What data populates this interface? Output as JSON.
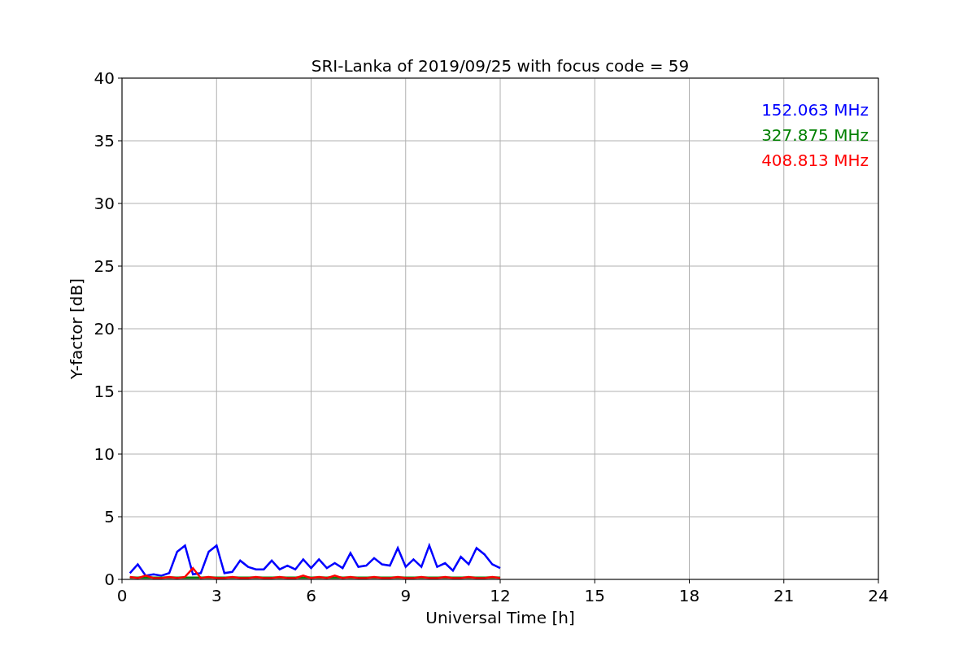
{
  "chart_data": {
    "type": "line",
    "title": "SRI-Lanka of 2019/09/25 with focus code = 59",
    "xlabel": "Universal Time [h]",
    "ylabel": "Y-factor [dB]",
    "x": [
      0.25,
      0.5,
      0.75,
      1.0,
      1.25,
      1.5,
      1.75,
      2.0,
      2.25,
      2.5,
      2.75,
      3.0,
      3.25,
      3.5,
      3.75,
      4.0,
      4.25,
      4.5,
      4.75,
      5.0,
      5.25,
      5.5,
      5.75,
      6.0,
      6.25,
      6.5,
      6.75,
      7.0,
      7.25,
      7.5,
      7.75,
      8.0,
      8.25,
      8.5,
      8.75,
      9.0,
      9.25,
      9.5,
      9.75,
      10.0,
      10.25,
      10.5,
      10.75,
      11.0,
      11.25,
      11.5,
      11.75,
      12.0
    ],
    "series": [
      {
        "name": "152.063 MHz",
        "color": "#0000ff",
        "values": [
          0.5,
          1.2,
          0.3,
          0.4,
          0.3,
          0.5,
          2.2,
          2.7,
          0.4,
          0.5,
          2.2,
          2.7,
          0.5,
          0.6,
          1.5,
          1.0,
          0.8,
          0.8,
          1.5,
          0.8,
          1.1,
          0.8,
          1.6,
          0.9,
          1.6,
          0.9,
          1.3,
          0.9,
          2.1,
          1.0,
          1.1,
          1.7,
          1.2,
          1.1,
          2.5,
          1.0,
          1.6,
          1.0,
          2.7,
          1.0,
          1.3,
          0.7,
          1.8,
          1.2,
          2.5,
          2.0,
          1.2,
          0.9
        ]
      },
      {
        "name": "327.875 MHz",
        "color": "#008000",
        "values": [
          0.15,
          0.15,
          0.15,
          0.15,
          0.15,
          0.15,
          0.15,
          0.15,
          0.15,
          0.15,
          0.15,
          0.15,
          0.15,
          0.15,
          0.15,
          0.15,
          0.15,
          0.15,
          0.15,
          0.15,
          0.15,
          0.15,
          0.15,
          0.15,
          0.15,
          0.15,
          0.15,
          0.15,
          0.15,
          0.15,
          0.15,
          0.15,
          0.15,
          0.15,
          0.15,
          0.15,
          0.15,
          0.15,
          0.15,
          0.15,
          0.15,
          0.15,
          0.15,
          0.15,
          0.15,
          0.15,
          0.15,
          0.15
        ]
      },
      {
        "name": "408.813 MHz",
        "color": "#ff0000",
        "values": [
          0.2,
          0.1,
          0.3,
          0.1,
          0.1,
          0.2,
          0.1,
          0.2,
          0.9,
          0.1,
          0.2,
          0.1,
          0.1,
          0.2,
          0.1,
          0.1,
          0.2,
          0.1,
          0.1,
          0.2,
          0.1,
          0.1,
          0.3,
          0.1,
          0.2,
          0.1,
          0.3,
          0.1,
          0.2,
          0.1,
          0.1,
          0.2,
          0.1,
          0.1,
          0.2,
          0.1,
          0.1,
          0.2,
          0.1,
          0.1,
          0.2,
          0.1,
          0.1,
          0.2,
          0.1,
          0.1,
          0.2,
          0.1
        ]
      }
    ],
    "grid": true,
    "xlim": [
      0,
      24
    ],
    "ylim": [
      0,
      40
    ],
    "xticks": [
      0,
      3,
      6,
      9,
      12,
      15,
      18,
      21,
      24
    ],
    "yticks": [
      0,
      5,
      10,
      15,
      20,
      25,
      30,
      35,
      40
    ]
  }
}
